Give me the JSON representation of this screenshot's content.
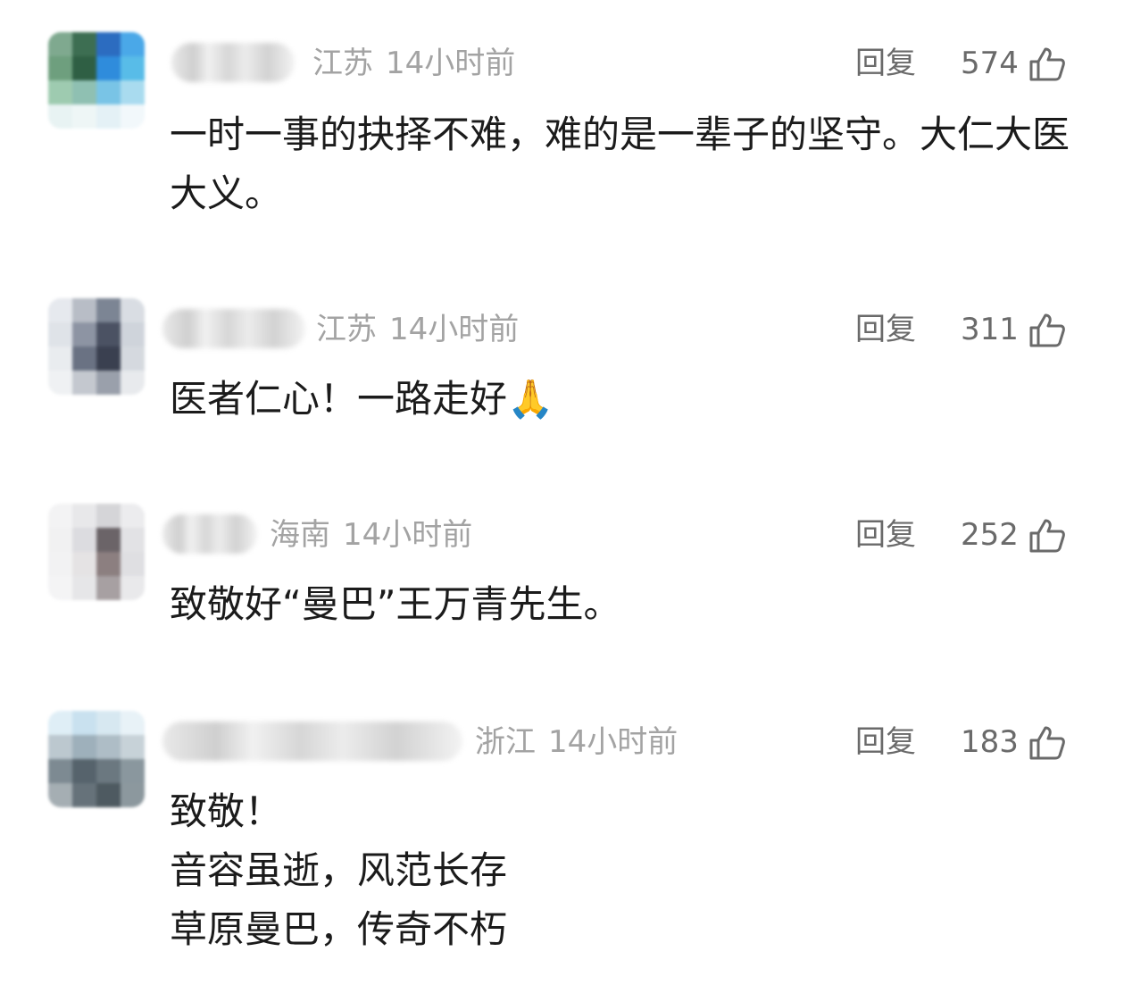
{
  "comments": [
    {
      "region": "江苏",
      "time": "14小时前",
      "reply_label": "回复",
      "likes": "574",
      "text": "一时一事的抉择不难，难的是一辈子的坚守。大仁大医大义。",
      "avatar_colors": [
        "#7fa98f",
        "#3d6e52",
        "#2c6cc0",
        "#4aa8e8",
        "#6e9f7e",
        "#2f5f44",
        "#2f8cdc",
        "#58bce8",
        "#9ecbb0",
        "#8fc0b2",
        "#79c4e6",
        "#a9dbef",
        "#e8f3f3",
        "#eef6f6",
        "#e4f1f6",
        "#f2f8fb"
      ]
    },
    {
      "region": "江苏",
      "time": "14小时前",
      "reply_label": "回复",
      "likes": "311",
      "text": "医者仁心！一路走好🙏",
      "avatar_colors": [
        "#e6e9ee",
        "#b8bdc6",
        "#7c8594",
        "#d9dde3",
        "#dfe3e8",
        "#8d94a3",
        "#4b5263",
        "#cfd4db",
        "#e9ecef",
        "#6a7283",
        "#3a4050",
        "#d5d9df",
        "#eff1f3",
        "#c4c8cf",
        "#9aa0ab",
        "#e8eaed"
      ]
    },
    {
      "region": "海南",
      "time": "14小时前",
      "reply_label": "回复",
      "likes": "252",
      "text": "致敬好“曼巴”王万青先生。",
      "avatar_colors": [
        "#f3f3f4",
        "#e8e8ea",
        "#d5d5d8",
        "#ececee",
        "#f1f1f2",
        "#dcdce0",
        "#6b6468",
        "#e2e2e5",
        "#f2f2f3",
        "#e5e3e4",
        "#8c7f80",
        "#dfdfe2",
        "#f4f4f5",
        "#e6e6e8",
        "#a7a0a2",
        "#e9e9eb"
      ]
    },
    {
      "region": "浙江",
      "time": "14小时前",
      "reply_label": "回复",
      "likes": "183",
      "text": "致敬！\n音容虽逝，风范长存\n草原曼巴，传奇不朽",
      "avatar_colors": [
        "#dfeef6",
        "#c9e1ef",
        "#d7e8f1",
        "#e8f2f7",
        "#bcc8cf",
        "#9eb0bb",
        "#aebdc6",
        "#c7d2d8",
        "#7d8a92",
        "#56636c",
        "#6b7880",
        "#8a979e",
        "#a5aeb3",
        "#66727a",
        "#4e5a61",
        "#8c989e"
      ]
    }
  ]
}
